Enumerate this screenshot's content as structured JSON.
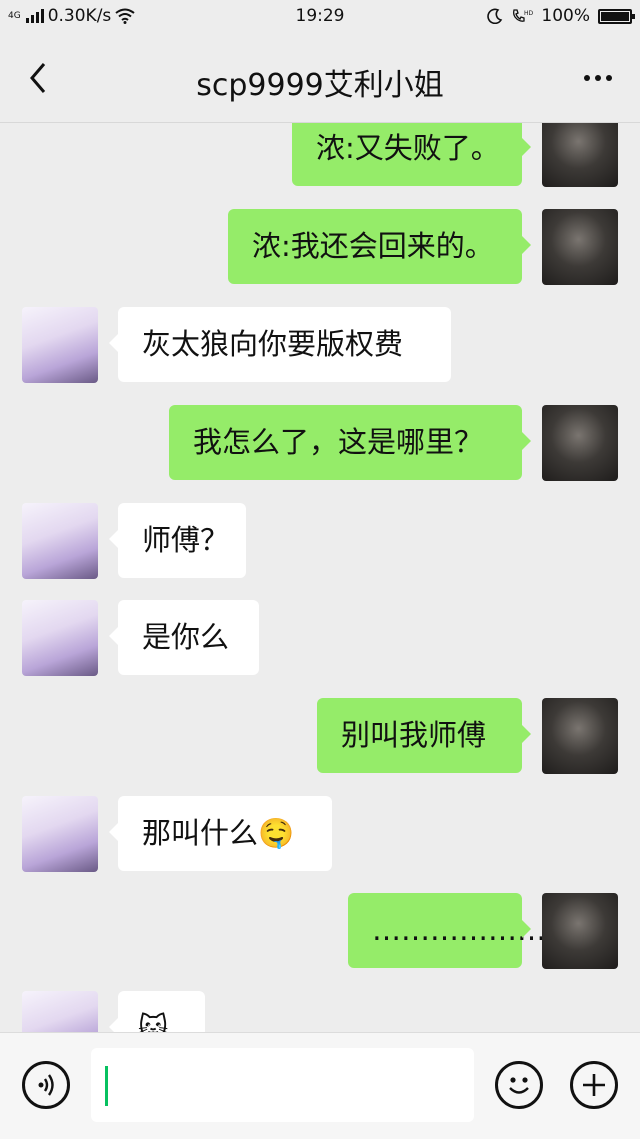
{
  "status_bar": {
    "network": "4G",
    "speed": "0.30K/s",
    "time": "19:29",
    "battery": "100%",
    "battery_level": 1.0,
    "icons": [
      "signal-icon",
      "wifi-icon",
      "moon-icon",
      "hd-call-icon",
      "battery-icon"
    ]
  },
  "header": {
    "title": "scp9999艾利小姐",
    "back_icon": "chevron-left-icon",
    "more_icon": "more-dots-icon"
  },
  "messages": [
    {
      "side": "right",
      "text": "浓:又失败了。"
    },
    {
      "side": "right",
      "text": "浓:我还会回来的。"
    },
    {
      "side": "left",
      "text": "灰太狼向你要版权费"
    },
    {
      "side": "right",
      "text": "我怎么了，这是哪里？"
    },
    {
      "side": "left",
      "text": "师傅？"
    },
    {
      "side": "left",
      "text": "是你么"
    },
    {
      "side": "right",
      "text": "别叫我师傅"
    },
    {
      "side": "left",
      "text": "那叫什么",
      "emoji": "🤤"
    },
    {
      "side": "right",
      "text": "………………"
    },
    {
      "side": "left",
      "text": "",
      "emoji": "🐱"
    }
  ],
  "input_bar": {
    "voice_icon": "voice-icon",
    "text_value": "",
    "emoji_icon": "emoji-icon",
    "plus_icon": "plus-icon"
  },
  "colors": {
    "background": "#ededed",
    "sent_bubble": "#95ec69",
    "received_bubble": "#ffffff",
    "caret": "#07c160"
  }
}
